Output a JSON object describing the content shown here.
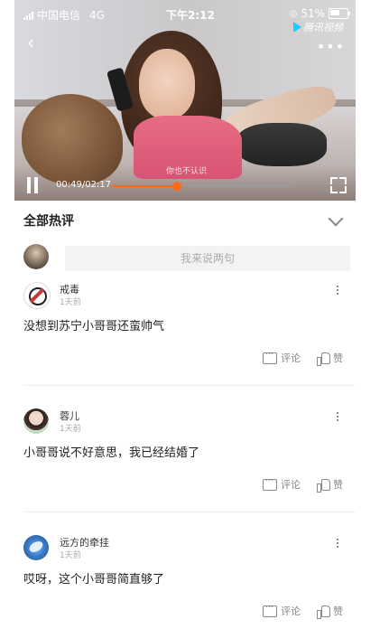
{
  "status_bar": {
    "carrier": "中国电信",
    "network": "4G",
    "time": "下午2:12",
    "battery": "51%"
  },
  "video": {
    "logo_text": "腾讯视频",
    "subtitle": "你也不认识",
    "time_display": "00:49/02:17",
    "progress": 0.36
  },
  "comments_section": {
    "title": "全部热评",
    "input_placeholder": "我来说两句",
    "comments": [
      {
        "name": "戒毒",
        "time": "1天前",
        "text": "没想到苏宁小哥哥还蛮帅气",
        "reply_label": "评论",
        "like_label": "赞"
      },
      {
        "name": "蓉儿",
        "time": "1天前",
        "text": "小哥哥说不好意思，我已经结婚了",
        "reply_label": "评论",
        "like_label": "赞"
      },
      {
        "name": "远方的牵挂",
        "time": "1天前",
        "text": "哎呀，这个小哥哥简直够了",
        "reply_label": "评论",
        "like_label": "赞"
      }
    ]
  },
  "colors": {
    "accent": "#ff6a1a",
    "logo_blue": "#16d0ff"
  }
}
